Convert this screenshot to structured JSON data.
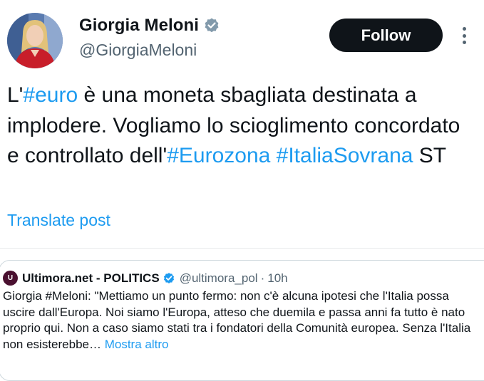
{
  "author": {
    "display_name": "Giorgia Meloni",
    "handle": "@GiorgiaMeloni",
    "verified": true
  },
  "actions": {
    "follow_label": "Follow",
    "more_icon": "more-vertical-icon"
  },
  "tweet": {
    "segments": [
      {
        "text": "L'"
      },
      {
        "text": "#euro",
        "hashtag": true
      },
      {
        "text": " è una moneta sbagliata destinata a implodere. Vogliamo lo scioglimento concordato e controllato dell'"
      },
      {
        "text": "#Eurozona",
        "hashtag": true
      },
      {
        "text": " "
      },
      {
        "text": "#ItaliaSovrana",
        "hashtag": true
      },
      {
        "text": " ST"
      }
    ],
    "translate_label": "Translate post"
  },
  "quote": {
    "logo_letter": "U",
    "display_name": "Ultimora.net - POLITICS",
    "verified": true,
    "handle": "@ultimora_pol",
    "separator": "·",
    "time": "10h",
    "text": "Giorgia #Meloni: \"Mettiamo un punto fermo: non c'è alcuna ipotesi che l'Italia possa uscire dall'Europa. Noi siamo l'Europa, atteso che duemila e passa anni fa tutto è nato proprio qui. Non a caso siamo stati tra i fondatori della Comunità europea. Senza l'Italia non esisterebbe…",
    "show_more_label": "Mostra altro"
  },
  "colors": {
    "link": "#1d9bf0",
    "text": "#0f1419",
    "secondary": "#536471",
    "follow_bg": "#0f1419"
  }
}
